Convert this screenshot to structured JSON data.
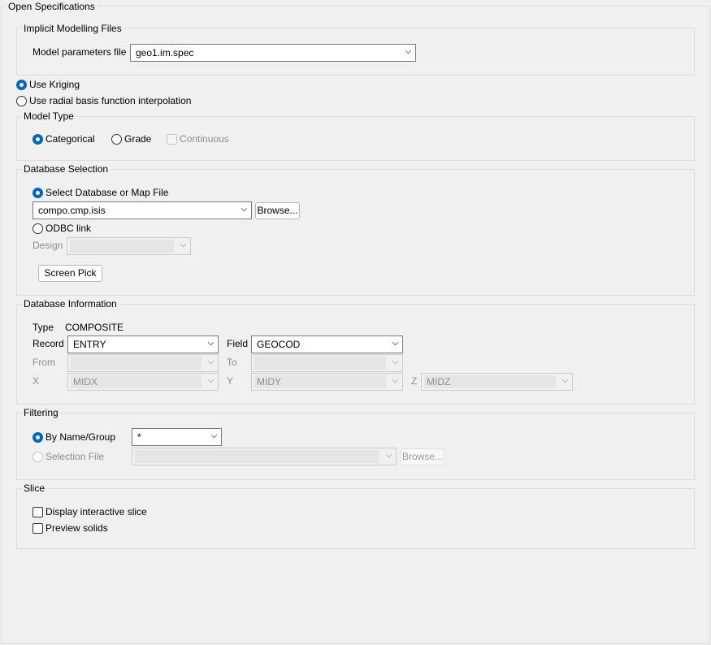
{
  "panel_title": "Open Specifications",
  "implicit": {
    "title": "Implicit Modelling Files",
    "model_label": "Model parameters file",
    "model_value": "geo1.im.spec"
  },
  "method": {
    "kriging": "Use Kriging",
    "rbf": "Use radial basis function interpolation",
    "selected": "kriging"
  },
  "model_type": {
    "title": "Model Type",
    "categorical": "Categorical",
    "grade": "Grade",
    "continuous": "Continuous",
    "selected": "categorical"
  },
  "db_selection": {
    "title": "Database Selection",
    "select_db": "Select Database or Map File",
    "db_value": "compo.cmp.isis",
    "browse": "Browse...",
    "odbc": "ODBC link",
    "design": "Design",
    "screen_pick": "Screen Pick"
  },
  "db_info": {
    "title": "Database Information",
    "type_label": "Type",
    "type_value": "COMPOSITE",
    "record_label": "Record",
    "record_value": "ENTRY",
    "field_label": "Field",
    "field_value": "GEOCOD",
    "from_label": "From",
    "to_label": "To",
    "x_label": "X",
    "x_value": "MIDX",
    "y_label": "Y",
    "y_value": "MIDY",
    "z_label": "Z",
    "z_value": "MIDZ"
  },
  "filtering": {
    "title": "Filtering",
    "by_name": "By Name/Group",
    "by_name_value": "*",
    "selection_file": "Selection File",
    "browse": "Browse..."
  },
  "slice": {
    "title": "Slice",
    "display": "Display interactive slice",
    "preview": "Preview solids"
  },
  "colors": {
    "accent": "#0067c0",
    "background": "#f0f0f0"
  }
}
